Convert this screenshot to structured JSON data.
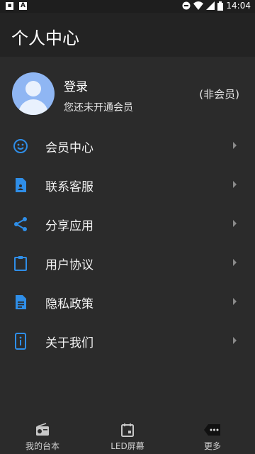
{
  "status_bar": {
    "time": "14:04"
  },
  "header": {
    "title": "个人中心"
  },
  "profile": {
    "login_label": "登录",
    "subscription_status": "您还未开通会员",
    "member_tag": "(非会员)"
  },
  "menu": [
    {
      "label": "会员中心",
      "icon": "smiley-icon"
    },
    {
      "label": "联系客服",
      "icon": "contact-card-icon"
    },
    {
      "label": "分享应用",
      "icon": "share-icon"
    },
    {
      "label": "用户协议",
      "icon": "clipboard-icon"
    },
    {
      "label": "隐私政策",
      "icon": "document-icon"
    },
    {
      "label": "关于我们",
      "icon": "phone-info-icon"
    }
  ],
  "bottom_nav": [
    {
      "label": "我的台本",
      "icon": "radio-icon"
    },
    {
      "label": "LED屏幕",
      "icon": "calendar-icon"
    },
    {
      "label": "更多",
      "icon": "more-icon",
      "active": true
    }
  ],
  "colors": {
    "accent": "#2f8ee8",
    "background": "#2b2b2b",
    "appbar": "#232323"
  }
}
